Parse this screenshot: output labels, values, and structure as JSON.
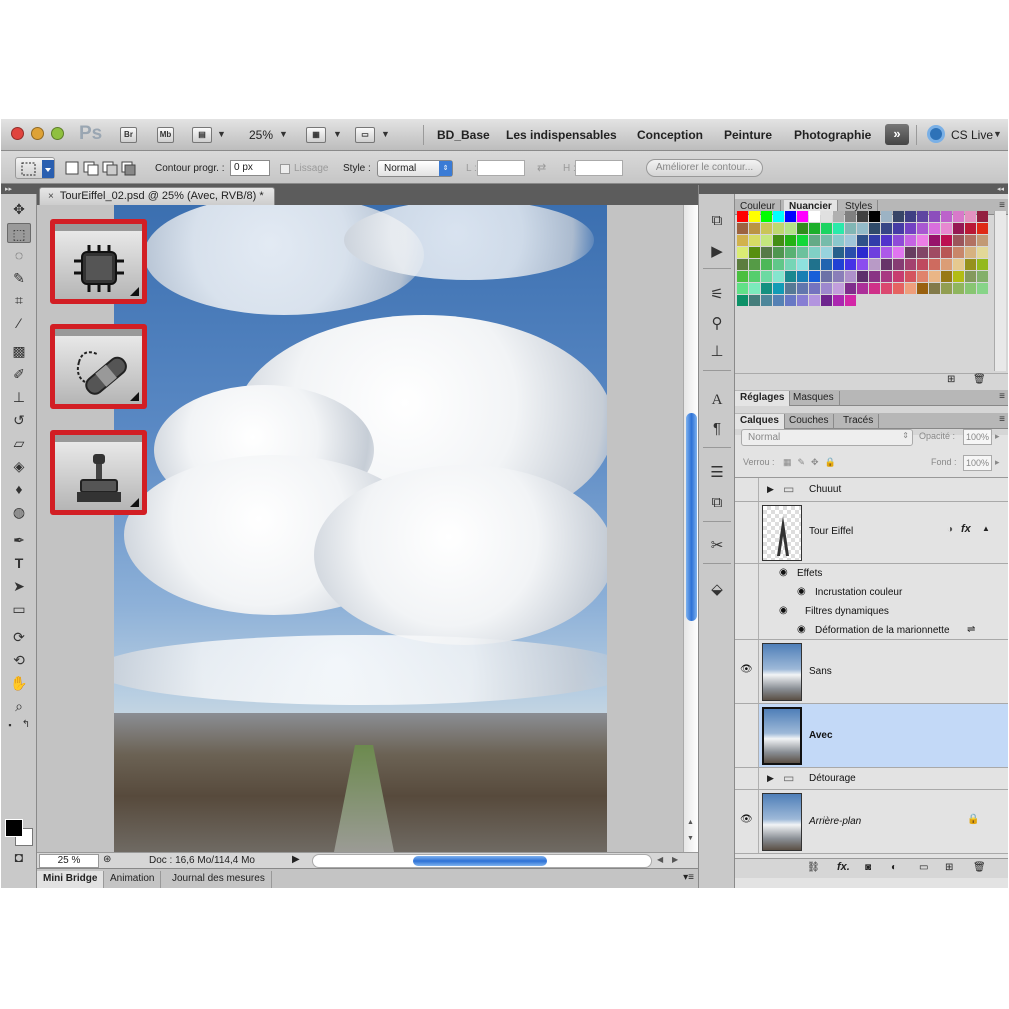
{
  "app": {
    "logo": "Ps",
    "buttons": {
      "bridge": "Br",
      "minibridge": "Mb"
    },
    "zoom": "25%",
    "workspaces": [
      "BD_Base",
      "Les indispensables",
      "Conception",
      "Peinture",
      "Photographie"
    ],
    "more": "»",
    "cslive": "CS Live"
  },
  "options": {
    "contour_label": "Contour progr. :",
    "contour_value": "0 px",
    "lissage": "Lissage",
    "style_label": "Style :",
    "style_value": "Normal",
    "l_label": "L :",
    "h_label": "H :",
    "refine_button": "Améliorer le contour..."
  },
  "document": {
    "tab_title": "TourEiffel_02.psd @ 25% (Avec, RVB/8) *",
    "tab_close": "×",
    "status_zoom": "25 %",
    "status_doc": "Doc : 16,6 Mo/114,4 Mo"
  },
  "bottom_tabs": [
    "Mini Bridge",
    "Animation",
    "Journal des mesures"
  ],
  "swatch_panel": {
    "tabs": [
      "Couleur",
      "Nuancier",
      "Styles"
    ],
    "active_tab": "Nuancier"
  },
  "adjust_panel": {
    "tabs": [
      "Réglages",
      "Masques"
    ]
  },
  "layers_panel": {
    "tabs": [
      "Calques",
      "Couches",
      "Tracés"
    ],
    "blend_mode": "Normal",
    "opacity_label": "Opacité :",
    "opacity_value": "100%",
    "lock_label": "Verrou :",
    "fill_label": "Fond :",
    "fill_value": "100%",
    "layers": [
      {
        "name": "Chuuut",
        "type": "group"
      },
      {
        "name": "Tour Eiffel",
        "type": "smart",
        "fx": "fx"
      },
      {
        "name": "Effets",
        "type": "effects"
      },
      {
        "name": "Incrustation couleur",
        "type": "effect"
      },
      {
        "name": "Filtres dynamiques",
        "type": "filters"
      },
      {
        "name": "Déformation de la marionnette",
        "type": "filter"
      },
      {
        "name": "Sans",
        "type": "image",
        "visible": true
      },
      {
        "name": "Avec",
        "type": "image",
        "selected": true
      },
      {
        "name": "Détourage",
        "type": "group"
      },
      {
        "name": "Arrière-plan",
        "type": "background",
        "visible": true,
        "locked": true
      }
    ]
  },
  "colors": {
    "selection_blue": "#c3d9f7",
    "callout_red": "#d21e24",
    "scroll_blue": "#2d71d6"
  }
}
